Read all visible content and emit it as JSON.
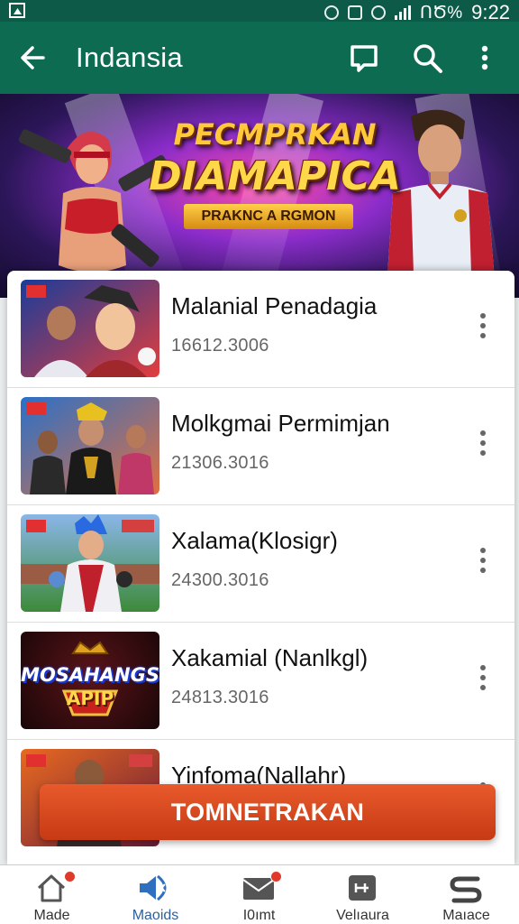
{
  "status_bar": {
    "battery": "ՈԾ%",
    "time": "9:22"
  },
  "app_bar": {
    "title": "Indansia",
    "icons": [
      "back-arrow-icon",
      "chat-icon",
      "search-icon",
      "more-vert-icon"
    ]
  },
  "banner": {
    "title_top": "PECMPRKAN",
    "title_main": "DIAMAPICA",
    "subtitle": "PRAKNC A RGMON"
  },
  "list": {
    "items": [
      {
        "name": "Malanial Penadagia",
        "date": "16612.3006"
      },
      {
        "name": "Molkgmai Permimjan",
        "date": "21306.3016"
      },
      {
        "name": "Xalama(Klosigr)",
        "date": "24300.3016"
      },
      {
        "name": "Xakamial (Nanlkgl)",
        "date": "24813.3016"
      },
      {
        "name": "Yinfoma(Nallahr)",
        "date": ""
      }
    ],
    "thumb_logo_text": "MOSAHANGS",
    "thumb_logo_sub": "APIP"
  },
  "cta": {
    "label": "TOMNETRAKAN"
  },
  "bottom_nav": {
    "items": [
      {
        "label": "Made",
        "icon": "home-icon"
      },
      {
        "label": "Maoids",
        "icon": "speaker-icon"
      },
      {
        "label": "I0ımt",
        "icon": "mail-icon"
      },
      {
        "label": "Velıaura",
        "icon": "tv-icon"
      },
      {
        "label": "Maıace",
        "icon": "s-logo-icon"
      }
    ]
  },
  "colors": {
    "appbar": "#0d6b52",
    "statusbar": "#0c5a47",
    "cta": "#d84a20",
    "active_nav": "#2f5f9a"
  }
}
